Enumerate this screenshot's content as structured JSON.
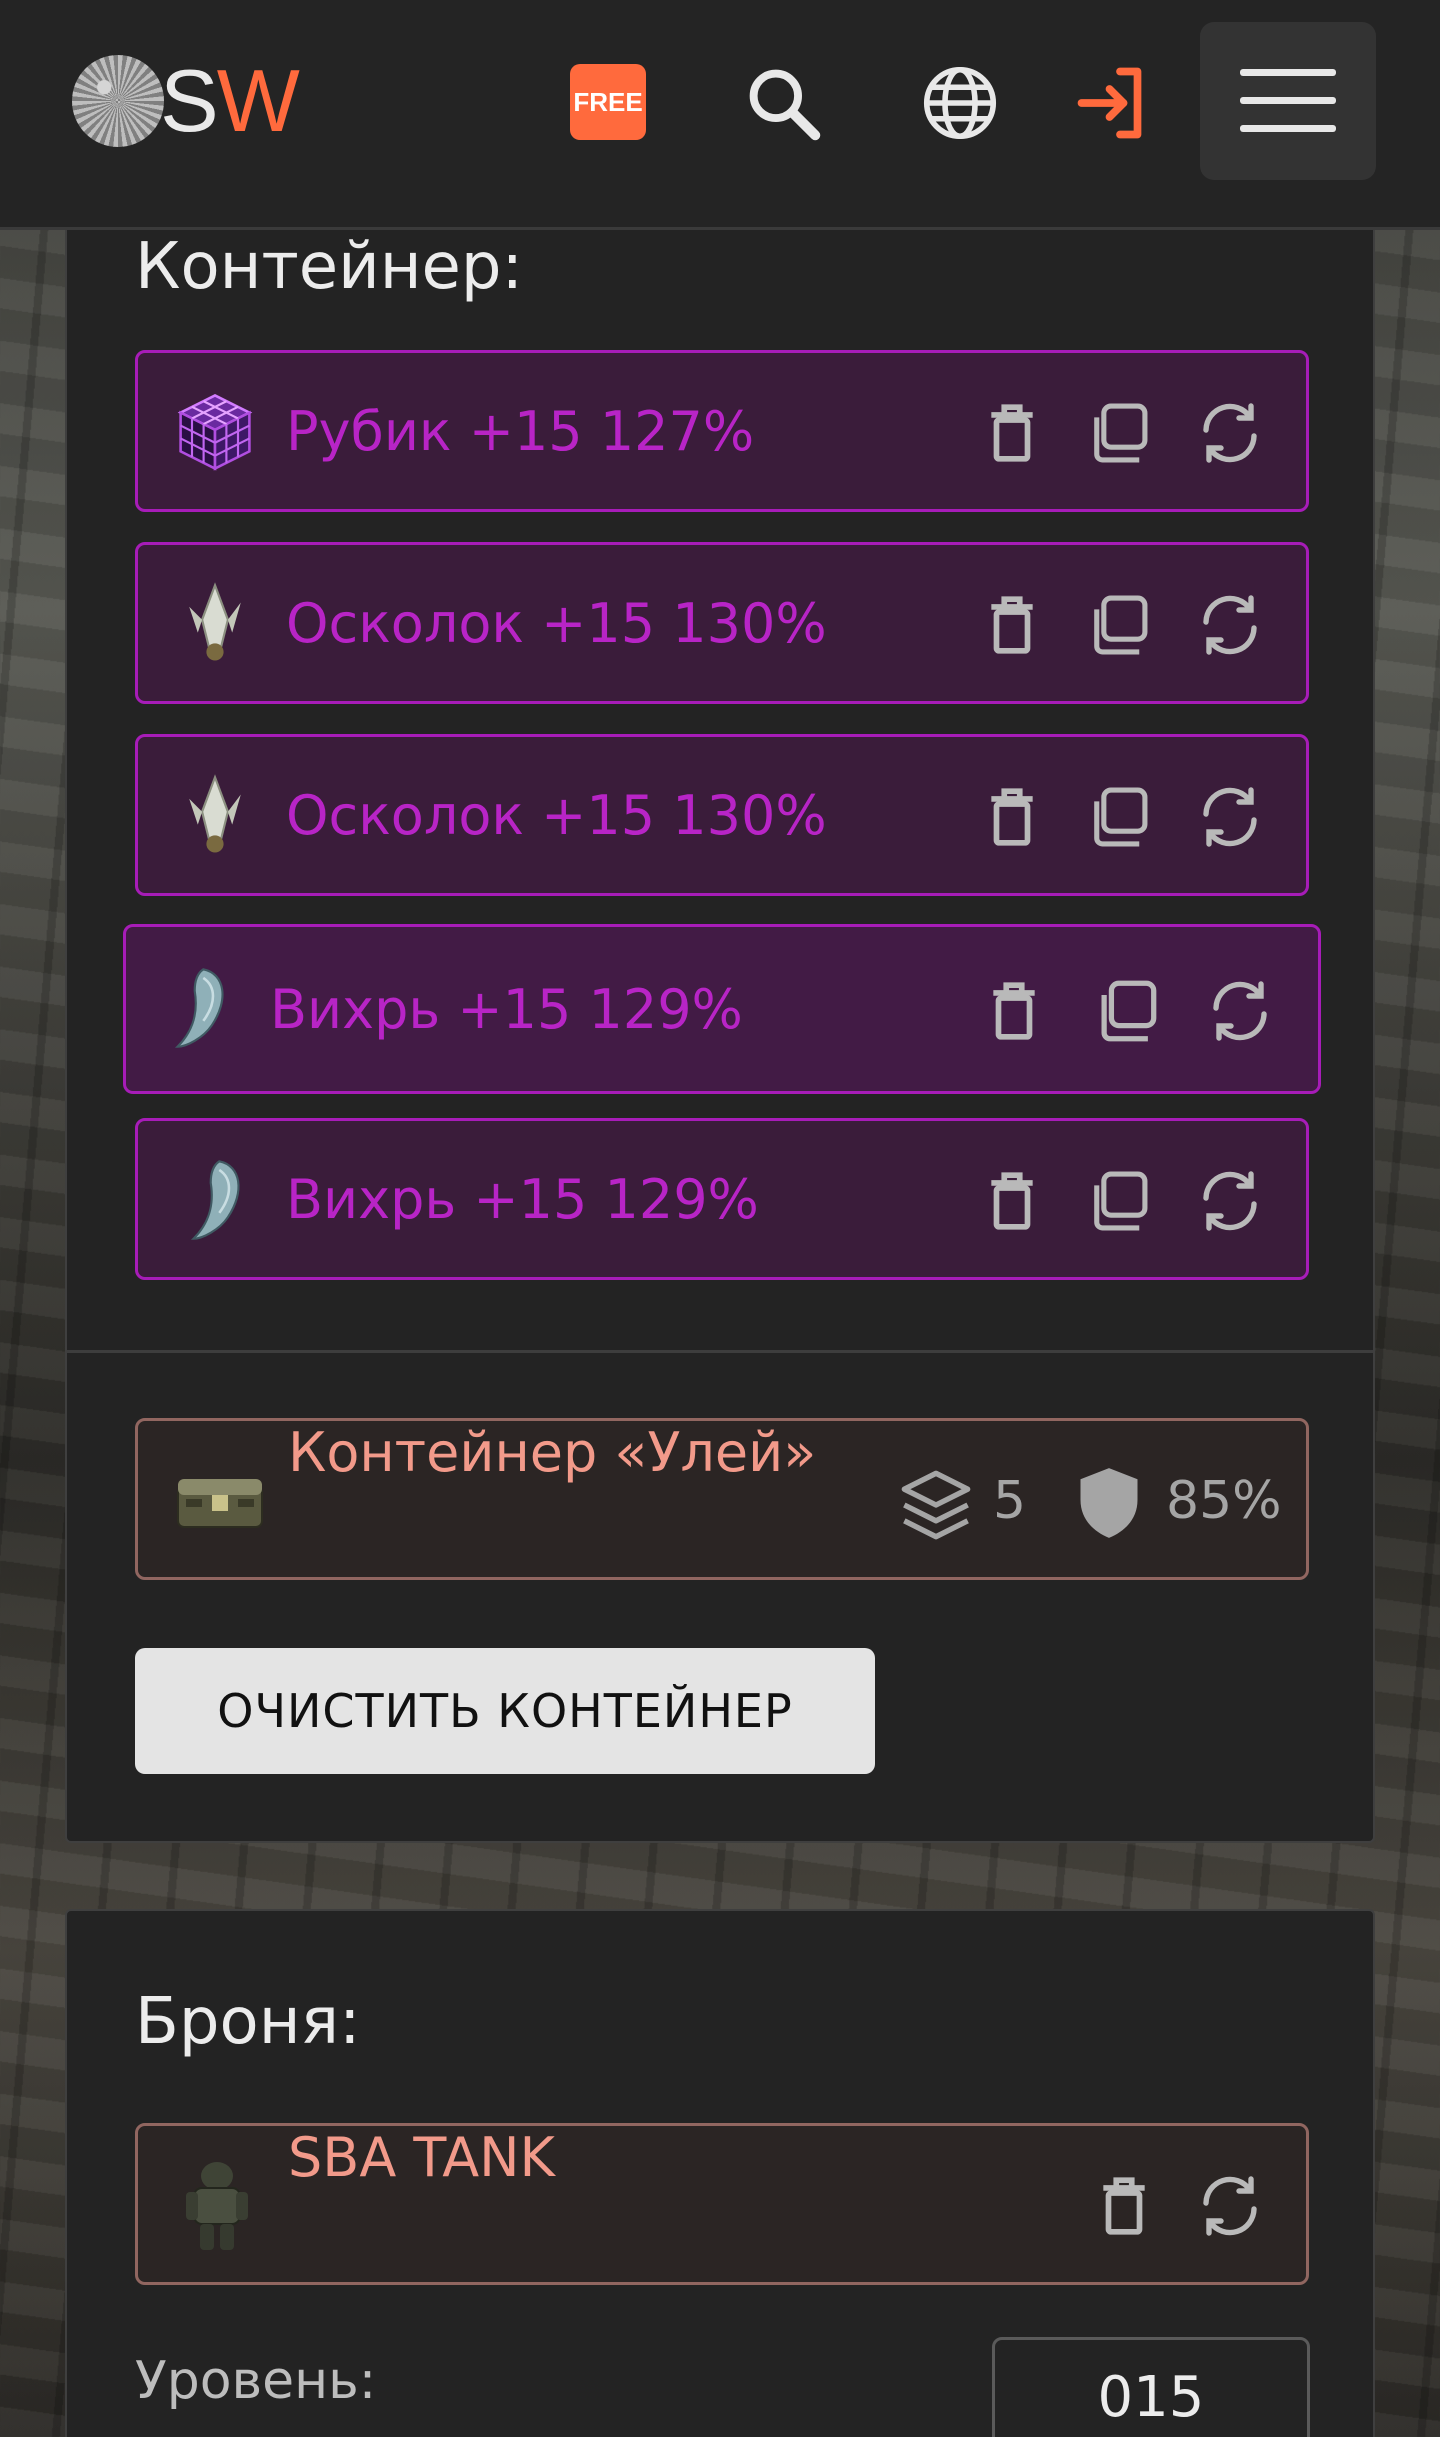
{
  "header": {
    "logo_s": "S",
    "logo_w": "W",
    "free_badge": "FREE",
    "icons": [
      "search-icon",
      "globe-icon",
      "login-icon",
      "menu-icon"
    ],
    "accent_color": "#ff6a3d"
  },
  "container_section": {
    "title": "Контейнер:",
    "items": [
      {
        "name": "Рубик +15 127%",
        "icon": "rubik-cube-icon"
      },
      {
        "name": "Осколок +15 130%",
        "icon": "crystal-shard-icon"
      },
      {
        "name": "Осколок +15 130%",
        "icon": "crystal-shard-icon"
      },
      {
        "name": "Вихрь +15 129%",
        "icon": "claw-icon"
      },
      {
        "name": "Вихрь +15 129%",
        "icon": "claw-icon"
      }
    ],
    "item_color": "#b824c6",
    "container": {
      "name": "Контейнер «Улей»",
      "slots": "5",
      "protection": "85%"
    },
    "clear_button": "ОЧИСТИТЬ КОНТЕЙНЕР"
  },
  "armor_section": {
    "title": "Броня:",
    "armor": {
      "name": "SBA TANK"
    },
    "level_label": "Уровень:",
    "level_value": "015"
  }
}
